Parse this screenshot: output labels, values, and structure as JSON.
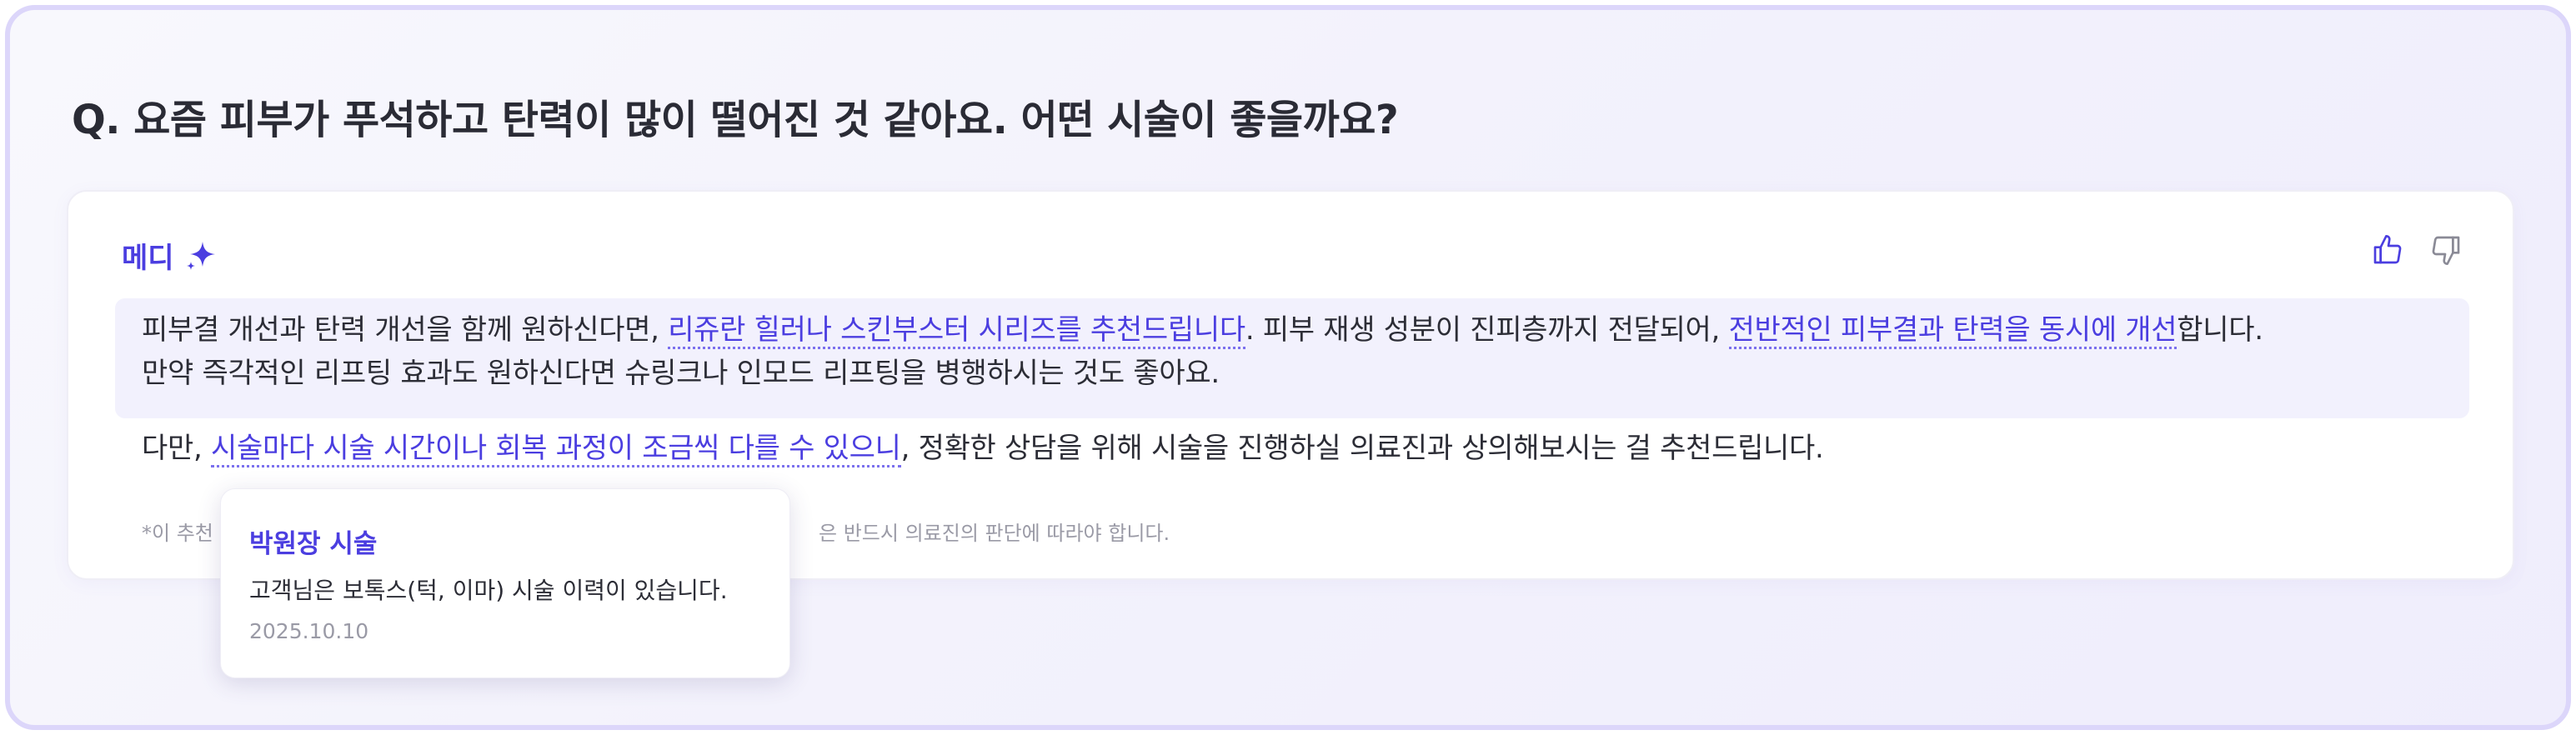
{
  "question": "Q. 요즘 피부가 푸석하고 탄력이 많이 떨어진 것 같아요. 어떤 시술이 좋을까요?",
  "answer": {
    "brand_label": "메디",
    "brand_icon": "sparkle-icon",
    "feedback": {
      "like_icon": "thumbs-up-icon",
      "dislike_icon": "thumbs-down-icon"
    },
    "paragraph1": {
      "t1": "피부결 개선과 탄력 개선을 함께 원하신다면, ",
      "link1": "리쥬란 힐러나 스킨부스터 시리즈를 추천드립니다",
      "t2": ". 피부 재생 성분이 진피층까지 전달되어, ",
      "link2": "전반적인 피부결과 탄력을 동시에 개선",
      "t3": "합니다.",
      "line2": "만약 즉각적인 리프팅 효과도 원하신다면 슈링크나 인모드 리프팅을 병행하시는 것도 좋아요."
    },
    "paragraph2": {
      "t1": "다만, ",
      "link1": "시술마다 시술 시간이나 회복 과정이 조금씩 다를 수 있으니",
      "t2": ", 정확한 상담을 위해 시술을 진행하실 의료진과 상의해보시는 걸 추천드립니다."
    },
    "footnote_left": "*이 추천",
    "footnote_right": "은 반드시 의료진의 판단에 따라야 합니다."
  },
  "tooltip": {
    "title": "박원장 시술",
    "body": "고객님은 보톡스(턱, 이마) 시술 이력이 있습니다.",
    "date": "2025.10.10"
  },
  "colors": {
    "accent": "#4b3ee0",
    "highlight_bg": "#f2f1fd",
    "frame_border": "#dcd6fa"
  }
}
